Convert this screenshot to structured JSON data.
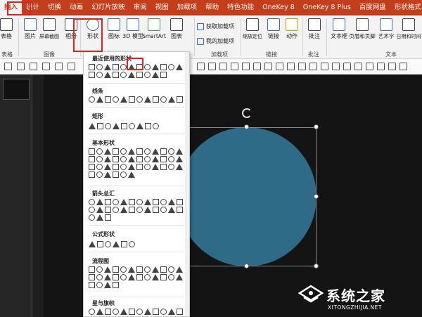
{
  "tabs": [
    "插入",
    "设计",
    "切换",
    "动画",
    "幻灯片放映",
    "审阅",
    "视图",
    "加载项",
    "帮助",
    "特色功能",
    "OneKey 8",
    "OneKey 8 Plus",
    "百度网盘",
    "形状格式"
  ],
  "ribbon": {
    "table_label": "表格",
    "table_group": "表格",
    "picture_label": "图片",
    "screenshot_label": "屏幕截图",
    "album_label": "相册",
    "image_group": "图像",
    "shapes_label": "形状",
    "icons_label": "图标",
    "model3d_label": "3D 模型",
    "smartart_label": "SmartArt",
    "chart_label": "图表",
    "get_addins": "获取加载项",
    "my_addins": "我的加载项",
    "addins_group": "加载项",
    "zoom_label": "缩放定位",
    "link_label": "链接",
    "action_label": "动作",
    "links_group": "链接",
    "comment_label": "批注",
    "comment_group": "批注",
    "textbox_label": "文本框",
    "header_footer_label": "页眉和页脚",
    "wordart_label": "艺术字",
    "datetime_label": "日期和时间",
    "text_group": "文本"
  },
  "shapes_gallery": {
    "sections": [
      {
        "title": "最近使用的形状",
        "count": 22
      },
      {
        "title": "线条",
        "count": 12
      },
      {
        "title": "矩形",
        "count": 9
      },
      {
        "title": "基本形状",
        "count": 42
      },
      {
        "title": "箭头总汇",
        "count": 27
      },
      {
        "title": "公式形状",
        "count": 6
      },
      {
        "title": "流程图",
        "count": 28
      },
      {
        "title": "星与旗帜",
        "count": 12
      }
    ]
  },
  "watermark": {
    "title": "系统之家",
    "subtitle": "XITONGZHIJIA.NET"
  },
  "colors": {
    "accent": "#c43e1c",
    "circle": "#2d6b87",
    "highlight": "#e0241a",
    "slide_bg": "#141414"
  }
}
